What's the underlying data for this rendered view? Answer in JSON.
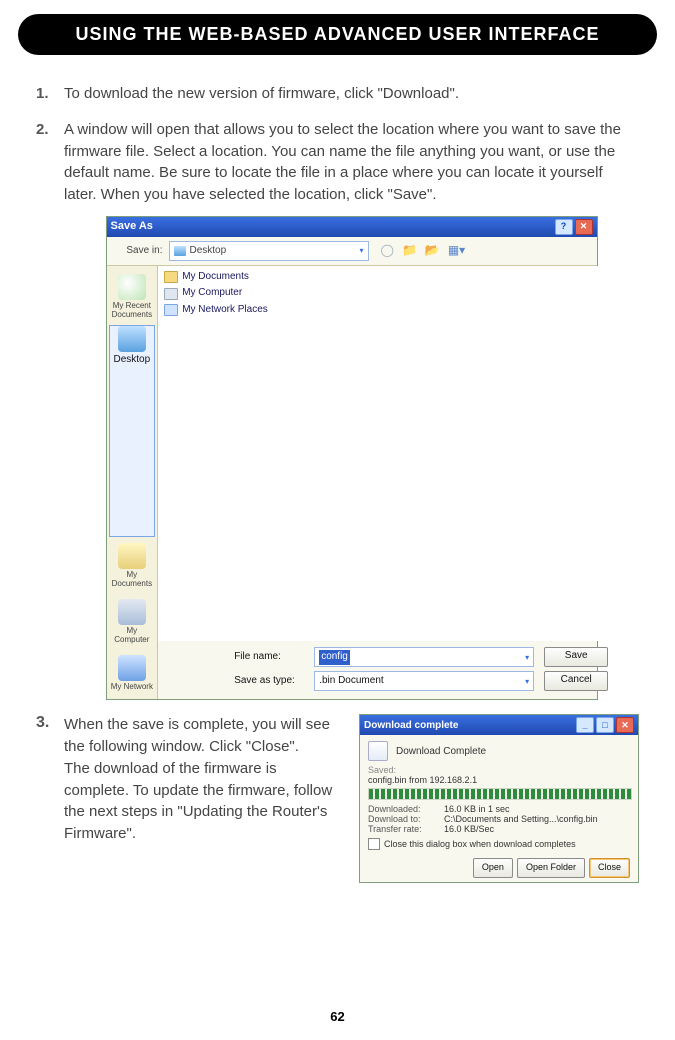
{
  "header": {
    "title": "USING THE WEB-BASED ADVANCED USER INTERFACE"
  },
  "steps": {
    "s1": {
      "num": "1.",
      "text": "To download the new version of firmware, click \"Download\"."
    },
    "s2": {
      "num": "2.",
      "text": "A window will open that allows you to select the location where you want to save the firmware file. Select a location. You can name the file anything you want, or use the default name. Be sure to locate the file in a place where you can locate it yourself later. When you have selected the location, click \"Save\"."
    },
    "s3": {
      "num": "3.",
      "text": "When the save is complete, you will see the following window. Click \"Close\".\nThe download of the firmware is complete. To update the firmware, follow the next steps in \"Updating the Router's Firmware\"."
    }
  },
  "saveAs": {
    "title": "Save As",
    "saveInLabel": "Save in:",
    "saveInValue": "Desktop",
    "places": {
      "recent": "My Recent Documents",
      "desktop": "Desktop",
      "mydocs": "My Documents",
      "mycomp": "My Computer",
      "mynet": "My Network"
    },
    "fileList": {
      "f1": "My Documents",
      "f2": "My Computer",
      "f3": "My Network Places"
    },
    "fileNameLabel": "File name:",
    "fileNameValue": "config",
    "saveTypeLabel": "Save as type:",
    "saveTypeValue": ".bin Document",
    "saveBtn": "Save",
    "cancelBtn": "Cancel"
  },
  "dlComplete": {
    "title": "Download complete",
    "heading": "Download Complete",
    "savedLabel": "Saved:",
    "savedValue": "config.bin from 192.168.2.1",
    "downloadedK": "Downloaded:",
    "downloadedV": "16.0 KB in 1 sec",
    "downloadToK": "Download to:",
    "downloadToV": "C:\\Documents and Setting...\\config.bin",
    "transferK": "Transfer rate:",
    "transferV": "16.0 KB/Sec",
    "closeBoxLabel": "Close this dialog box when download completes",
    "openBtn": "Open",
    "openFolderBtn": "Open Folder",
    "closeBtn": "Close"
  },
  "pageNumber": "62"
}
